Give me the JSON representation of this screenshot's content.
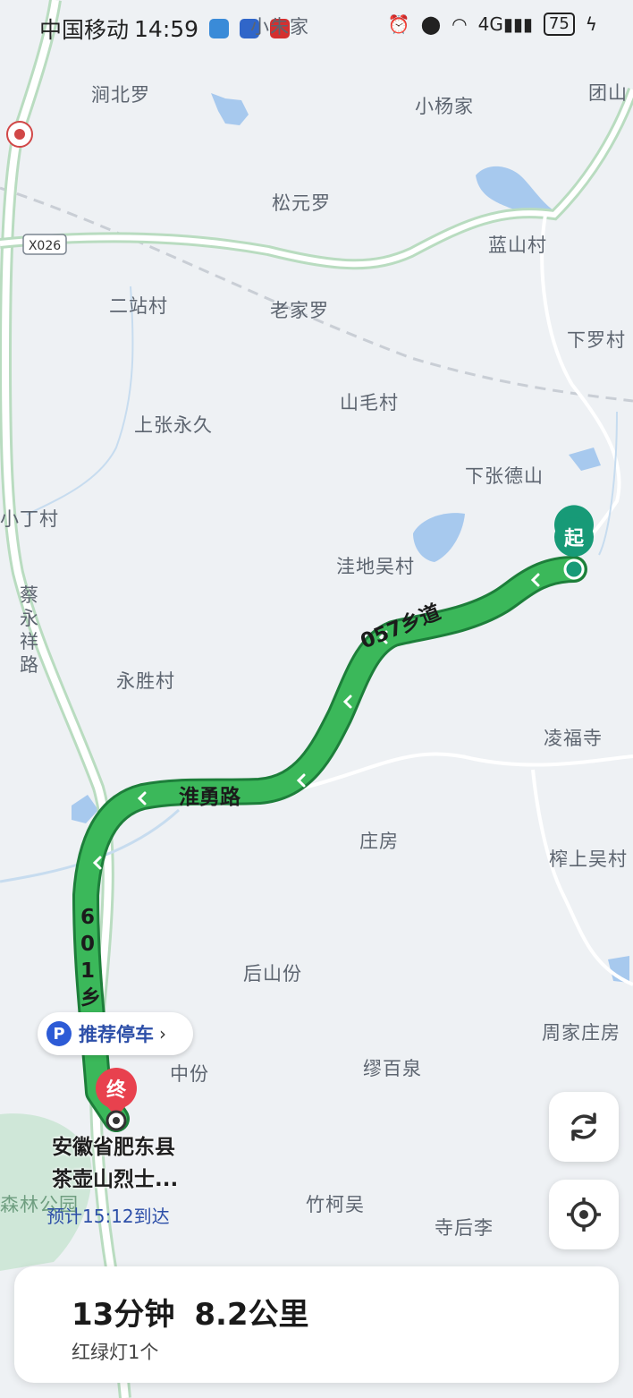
{
  "status_bar": {
    "carrier": "中国移动",
    "time": "14:59",
    "network": "4G",
    "battery": "75"
  },
  "map": {
    "places": [
      {
        "name": "小朱家",
        "id": "xiaozhujia"
      },
      {
        "name": "涧北罗",
        "id": "jianbeiluo"
      },
      {
        "name": "小杨家",
        "id": "xiaoyangjia"
      },
      {
        "name": "团山",
        "id": "tuanshan"
      },
      {
        "name": "松元罗",
        "id": "songyuanluo"
      },
      {
        "name": "蓝山村",
        "id": "lanshancun"
      },
      {
        "name": "二站村",
        "id": "erzhancun"
      },
      {
        "name": "老家罗",
        "id": "laojialuo"
      },
      {
        "name": "下罗村",
        "id": "xialuocun"
      },
      {
        "name": "山毛村",
        "id": "shanmaocun"
      },
      {
        "name": "上张永久",
        "id": "shangzhangyongjiu"
      },
      {
        "name": "下张德山",
        "id": "xiazhangdeshan"
      },
      {
        "name": "小丁村",
        "id": "xiaodingcun"
      },
      {
        "name": "洼地吴村",
        "id": "wadiwucun"
      },
      {
        "name": "永胜村",
        "id": "yongshengcun"
      },
      {
        "name": "凌福寺",
        "id": "lingfusi"
      },
      {
        "name": "庄房",
        "id": "zhuangfang"
      },
      {
        "name": "榨上吴村",
        "id": "zhashangwucun"
      },
      {
        "name": "后山份",
        "id": "houshanfen"
      },
      {
        "name": "周家庄房",
        "id": "zhoujiazhuangfang"
      },
      {
        "name": "中份",
        "id": "zhongfen"
      },
      {
        "name": "缪百泉",
        "id": "miaobaiquan"
      },
      {
        "name": "竹柯吴",
        "id": "zhukewu"
      },
      {
        "name": "寺后李",
        "id": "sihouli"
      },
      {
        "name": "森林公园",
        "id": "senlingongyuan"
      }
    ],
    "road_code": "X026",
    "side_road": "蔡永祥路",
    "route_roads": {
      "road1_label": "057乡道",
      "road2_label": "淮勇路",
      "road3_label": "601乡道"
    },
    "start_marker": "起",
    "end_marker": "终",
    "route_color": "#2fa84f",
    "start_color": "#179a77",
    "end_color": "#e8414e"
  },
  "parking": {
    "icon": "P",
    "label": "推荐停车"
  },
  "destination": {
    "line1": "安徽省肥东县",
    "line2": "茶壶山烈士...",
    "eta": "预计15:12到达"
  },
  "summary": {
    "duration": "13分钟",
    "distance": "8.2公里",
    "traffic_lights": "红绿灯1个"
  }
}
